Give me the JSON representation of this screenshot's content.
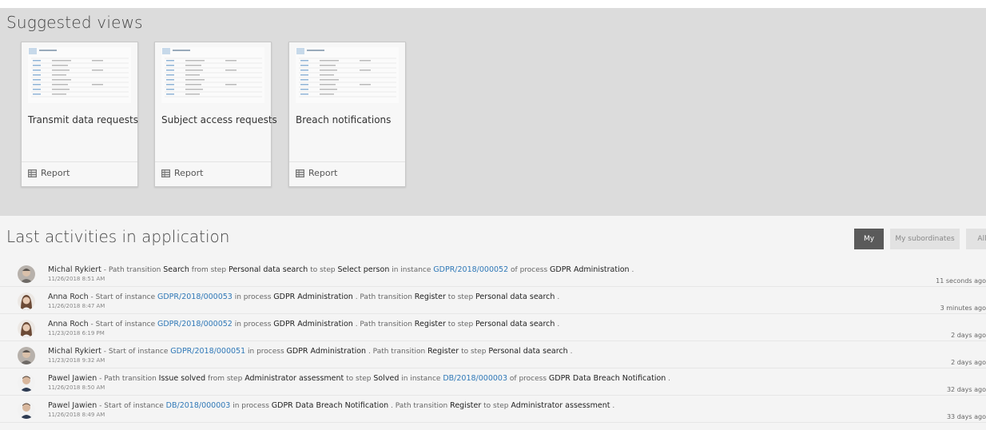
{
  "suggested": {
    "title": "Suggested views",
    "tiles": [
      {
        "title": "Transmit data requests",
        "footer_icon": "table-icon",
        "footer_label": "Report"
      },
      {
        "title": "Subject access requests",
        "footer_icon": "table-icon",
        "footer_label": "Report"
      },
      {
        "title": "Breach notifications",
        "footer_icon": "table-icon",
        "footer_label": "Report"
      }
    ]
  },
  "activities": {
    "title": "Last activities in application",
    "filters": {
      "my": "My",
      "subordinates": "My subordinates",
      "all": "All"
    },
    "items": [
      {
        "user": "Michal Rykiert",
        "t1": "- Path transition",
        "b1": "Search",
        "t2": "from step",
        "b2": "Personal data search",
        "t3": "to step",
        "b3": "Select person",
        "t4": "in instance",
        "link": "GDPR/2018/000052",
        "t5": "of process",
        "b4": "GDPR Administration",
        "t6": ".",
        "date": "11/26/2018 8:51 AM",
        "ago": "11 seconds ago"
      },
      {
        "user": "Anna Roch",
        "t1": "- Start of instance",
        "link": "GDPR/2018/000053",
        "t2": "in process",
        "b1": "GDPR Administration",
        "t3": ". Path transition",
        "b2": "Register",
        "t4": "to step",
        "b3": "Personal data search",
        "t5": ".",
        "date": "11/26/2018 8:47 AM",
        "ago": "3 minutes ago"
      },
      {
        "user": "Anna Roch",
        "t1": "- Start of instance",
        "link": "GDPR/2018/000052",
        "t2": "in process",
        "b1": "GDPR Administration",
        "t3": ". Path transition",
        "b2": "Register",
        "t4": "to step",
        "b3": "Personal data search",
        "t5": ".",
        "date": "11/23/2018 6:19 PM",
        "ago": "2 days ago"
      },
      {
        "user": "Michal Rykiert",
        "t1": "- Start of instance",
        "link": "GDPR/2018/000051",
        "t2": "in process",
        "b1": "GDPR Administration",
        "t3": ". Path transition",
        "b2": "Register",
        "t4": "to step",
        "b3": "Personal data search",
        "t5": ".",
        "date": "11/23/2018 9:32 AM",
        "ago": "2 days ago"
      },
      {
        "user": "Pawel Jawien",
        "t1": "- Path transition",
        "b1": "Issue solved",
        "t2": "from step",
        "b2": "Administrator assessment",
        "t3": "to step",
        "b3": "Solved",
        "t4": "in instance",
        "link": "DB/2018/000003",
        "t5": "of process",
        "b4": "GDPR Data Breach Notification",
        "t6": ".",
        "date": "11/26/2018 8:50 AM",
        "ago": "32 days ago"
      },
      {
        "user": "Pawel Jawien",
        "t1": "- Start of instance",
        "link": "DB/2018/000003",
        "t2": "in process",
        "b1": "GDPR Data Breach Notification",
        "t3": ". Path transition",
        "b2": "Register",
        "t4": "to step",
        "b3": "Administrator assessment",
        "t5": ".",
        "date": "11/26/2018 8:49 AM",
        "ago": "33 days ago"
      }
    ]
  }
}
